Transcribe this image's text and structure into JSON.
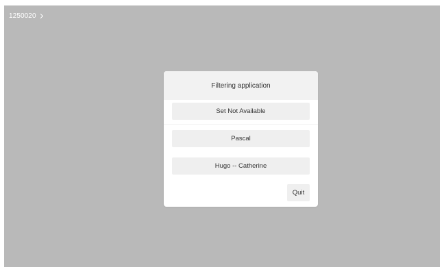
{
  "breadcrumb": {
    "label": "1250020",
    "chevron_icon": "chevron-right-icon"
  },
  "dialog": {
    "title": "Filtering application",
    "options": [
      {
        "label": "Set Not Available"
      },
      {
        "label": "Pascal"
      },
      {
        "label": "Hugo -- Catherine"
      }
    ],
    "quit_label": "Quit"
  },
  "colors": {
    "backdrop": "#b9b9b9",
    "dialog_bg": "#ffffff",
    "header_bg": "#f2f2f2",
    "button_bg": "#efefef",
    "text": "#333333",
    "breadcrumb_text": "#ffffff"
  }
}
